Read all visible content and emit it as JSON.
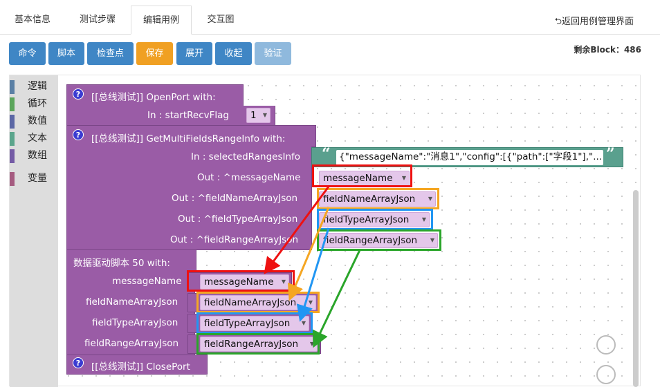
{
  "tabs": [
    {
      "label": "基本信息"
    },
    {
      "label": "测试步骤"
    },
    {
      "label": "编辑用例"
    },
    {
      "label": "交互图"
    }
  ],
  "return_link": "⮌返回用例管理界面",
  "toolbar": {
    "buttons": [
      {
        "label": "命令"
      },
      {
        "label": "脚本"
      },
      {
        "label": "检查点"
      },
      {
        "label": "保存"
      },
      {
        "label": "展开"
      },
      {
        "label": "收起"
      },
      {
        "label": "验证"
      }
    ],
    "block_count": "剩余Block：486"
  },
  "toolbox": {
    "categories": [
      {
        "label": "逻辑",
        "color": "#5b80a5"
      },
      {
        "label": "循环",
        "color": "#5ba55b"
      },
      {
        "label": "数值",
        "color": "#5b67a5"
      },
      {
        "label": "文本",
        "color": "#5ba58c"
      },
      {
        "label": "数组",
        "color": "#745ba5"
      },
      {
        "label": "变量",
        "color": "#a55b80"
      }
    ]
  },
  "blocks": {
    "open_port": {
      "help": "?",
      "title": "[[总线测试]]  OpenPort  with:",
      "param_label": "In : startRecvFlag",
      "param_value": "1"
    },
    "get_multi": {
      "help": "?",
      "title": "[[总线测试]]  GetMultiFieldsRangeInfo  with:",
      "in_label": "In : selectedRangesInfo",
      "in_value": "{\"messageName\":\"消息1\",\"config\":[{\"path\":[\"字段1\"],\"...",
      "out1_label": "Out : ^messageName",
      "out1_value": "messageName",
      "out2_label": "Out : ^fieldNameArrayJson",
      "out2_value": "fieldNameArrayJson",
      "out3_label": "Out : ^fieldTypeArrayJson",
      "out3_value": "fieldTypeArrayJson",
      "out4_label": "Out : ^fieldRangeArrayJson",
      "out4_value": "fieldRangeArrayJson"
    },
    "script": {
      "title": "数据驱动脚本  50  with:",
      "p1_label": "messageName",
      "p1_value": "messageName",
      "p2_label": "fieldNameArrayJson",
      "p2_value": "fieldNameArrayJson",
      "p3_label": "fieldTypeArrayJson",
      "p3_value": "fieldTypeArrayJson",
      "p4_label": "fieldRangeArrayJson",
      "p4_value": "fieldRangeArrayJson"
    },
    "close_port": {
      "help": "?",
      "title": "[[总线测试]]  ClosePort"
    }
  },
  "annotation_colors": {
    "message": "#ee1111",
    "name": "#f5a623",
    "type": "#2196f3",
    "range": "#2aa52a"
  }
}
